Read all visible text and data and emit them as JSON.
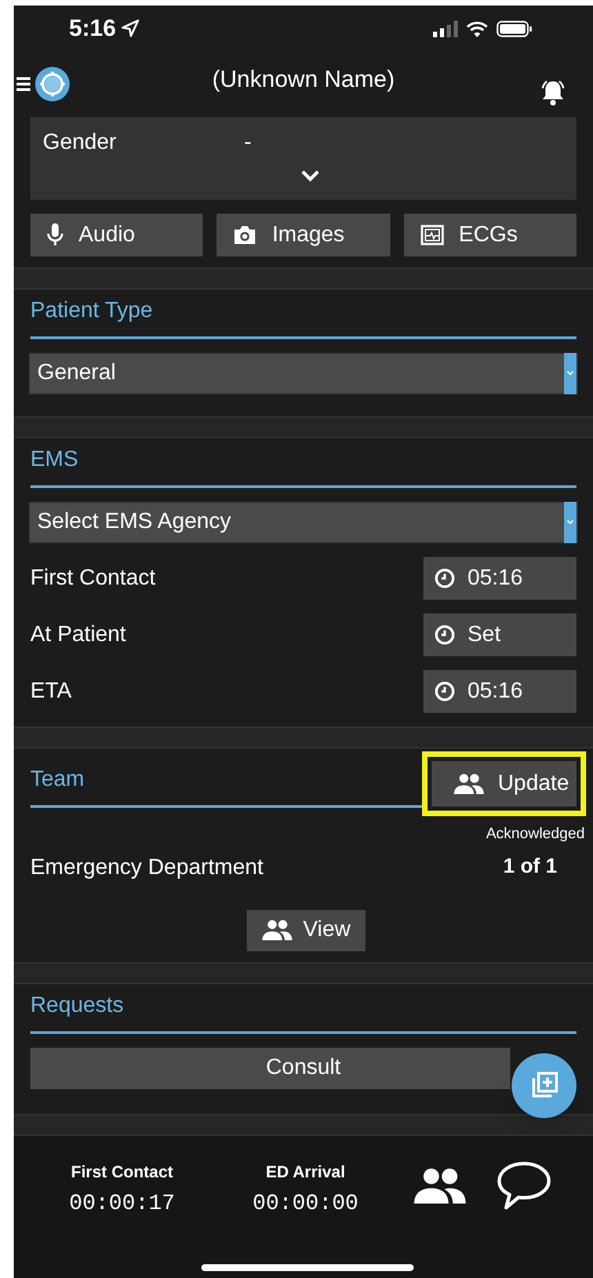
{
  "status_bar": {
    "time": "5:16"
  },
  "header": {
    "title": "(Unknown Name)"
  },
  "demographics": {
    "label": "Gender",
    "value": "-"
  },
  "media_buttons": [
    {
      "kind": "audio",
      "label": "Audio"
    },
    {
      "kind": "images",
      "label": "Images"
    },
    {
      "kind": "ecg",
      "label": "ECGs"
    }
  ],
  "patient_type": {
    "heading": "Patient Type",
    "value": "General"
  },
  "ems": {
    "heading": "EMS",
    "agency": "Select EMS Agency",
    "rows": [
      {
        "label": "First Contact",
        "value": "05:16"
      },
      {
        "label": "At Patient",
        "value": "Set"
      },
      {
        "label": "ETA",
        "value": "05:16"
      }
    ]
  },
  "team": {
    "heading": "Team",
    "update_button": {
      "label": "Update",
      "highlighted": true
    },
    "acknowledged_label": "Acknowledged",
    "department": "Emergency Department",
    "count": "1 of 1",
    "view_button": "View"
  },
  "requests": {
    "heading": "Requests",
    "button": "Consult"
  },
  "timers": [
    {
      "label": "First Contact",
      "value": "00:00:17"
    },
    {
      "label": "ED Arrival",
      "value": "00:00:00"
    }
  ]
}
